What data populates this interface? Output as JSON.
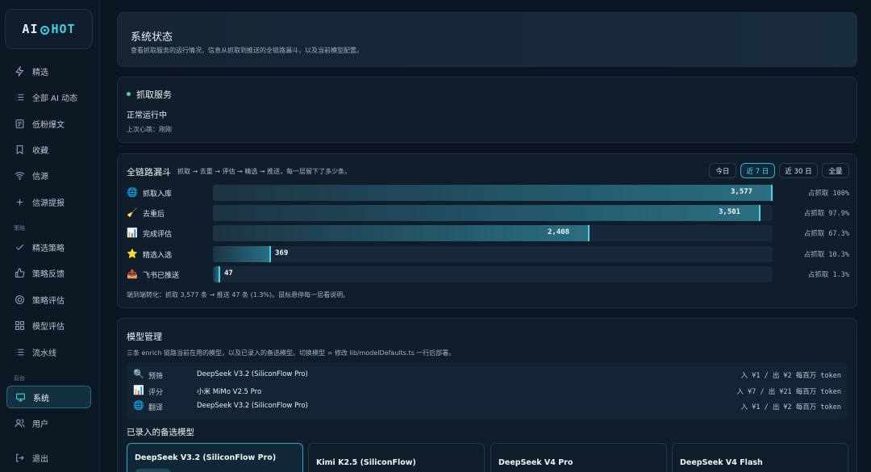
{
  "logo": {
    "text_left": "AI",
    "text_right": "HOT"
  },
  "nav": {
    "items": [
      {
        "label": "精选",
        "icon": "zap-icon"
      },
      {
        "label": "全部 AI 动态",
        "icon": "list-icon"
      },
      {
        "label": "低粉爆文",
        "icon": "article-icon"
      },
      {
        "label": "收藏",
        "icon": "bookmark-icon"
      },
      {
        "label": "信源",
        "icon": "wifi-icon"
      },
      {
        "label": "信源提报",
        "icon": "plus-icon"
      }
    ],
    "group_strategy": "策略",
    "strategy_items": [
      {
        "label": "精选策略",
        "icon": "check-icon"
      },
      {
        "label": "策略反馈",
        "icon": "thumbs-up-icon"
      },
      {
        "label": "策略评估",
        "icon": "target-icon"
      },
      {
        "label": "模型评估",
        "icon": "grid-icon"
      },
      {
        "label": "流水线",
        "icon": "list-icon"
      }
    ],
    "group_admin": "后台",
    "admin_items": [
      {
        "label": "系统",
        "icon": "monitor-icon",
        "active": true
      },
      {
        "label": "用户",
        "icon": "users-icon"
      }
    ],
    "logout": "退出"
  },
  "header": {
    "title": "系统状态",
    "subtitle": "查看抓取服务的运行情况、信息从抓取到推送的全链路漏斗，以及当前模型配置。"
  },
  "service": {
    "name": "抓取服务",
    "status": "正常运行中",
    "heartbeat": "上次心跳：刚刚",
    "status_color": "#3ddc97"
  },
  "funnel": {
    "title": "全链路漏斗",
    "desc": "抓取 → 去重 → 评估 → 精选 → 推送，每一层留下了多少条。",
    "ranges": [
      {
        "label": "今日",
        "active": false
      },
      {
        "label": "近 7 日",
        "active": true
      },
      {
        "label": "近 30 日",
        "active": false
      },
      {
        "label": "全量",
        "active": false
      }
    ],
    "note": "端到端转化：抓取 3,577 条 → 推送 47 条 (1.3%)。鼠标悬停每一层看说明。"
  },
  "chart_data": {
    "type": "bar",
    "categories": [
      "抓取入库",
      "去重后",
      "完成评估",
      "精选入选",
      "飞书已推送"
    ],
    "values": [
      3577,
      3501,
      2408,
      369,
      47
    ],
    "value_labels": [
      "3,577",
      "3,501",
      "2,408",
      "369",
      "47"
    ],
    "percent_labels": [
      "占抓取 100%",
      "占抓取 97.9%",
      "占抓取 67.3%",
      "占抓取 10.3%",
      "占抓取 1.3%"
    ],
    "icons": [
      "🌐",
      "🧹",
      "📊",
      "⭐",
      "📤"
    ],
    "max": 3577,
    "accent": "#44d3ea"
  },
  "models": {
    "title": "模型管理",
    "desc": "三条 enrich 链路当前在用的模型，以及已录入的备选模型。切换模型 = 修改 lib/modelDefaults.ts 一行后部署。",
    "current": [
      {
        "icon": "🔍",
        "role": "预筛",
        "name": "DeepSeek V3.2 (SiliconFlow Pro)",
        "price": "入 ¥1 / 出 ¥2 每百万 token"
      },
      {
        "icon": "📊",
        "role": "评分",
        "name": "小米 MiMo V2.5 Pro",
        "price": "入 ¥7 / 出 ¥21 每百万 token"
      },
      {
        "icon": "🌐",
        "role": "翻译",
        "name": "DeepSeek V3.2 (SiliconFlow Pro)",
        "price": "入 ¥1 / 出 ¥2 每百万 token"
      }
    ],
    "alt_title": "已录入的备选模型",
    "alternatives": [
      {
        "name": "DeepSeek V3.2 (SiliconFlow Pro)",
        "active": true
      },
      {
        "name": "Kimi K2.5 (SiliconFlow)",
        "active": false
      },
      {
        "name": "DeepSeek V4 Pro",
        "active": false
      },
      {
        "name": "DeepSeek V4 Flash",
        "active": false
      }
    ]
  }
}
